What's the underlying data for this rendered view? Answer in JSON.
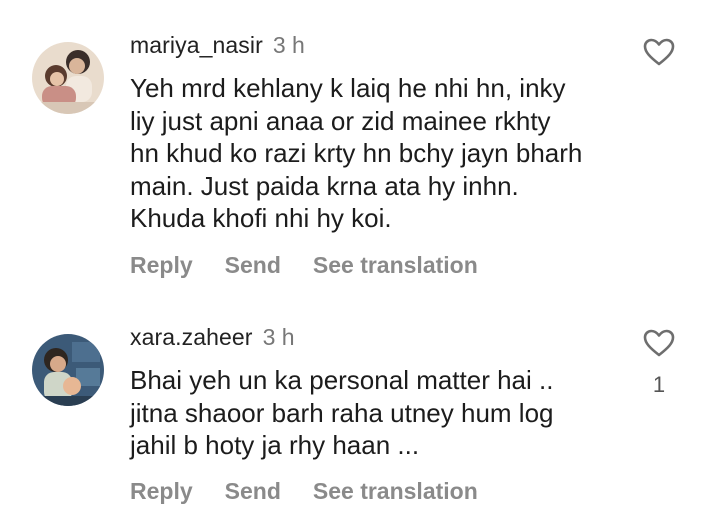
{
  "comments": [
    {
      "username": "mariya_nasir",
      "time": "3 h",
      "text_lines": [
        "Yeh mrd kehlany k laiq he nhi hn, inky",
        "liy just apni anaa or zid mainee rkhty",
        "hn khud ko razi krty hn bchy jayn bharh",
        "main. Just paida krna ata hy inhn.",
        "Khuda khofi nhi hy koi."
      ],
      "reply_label": "Reply",
      "send_label": "Send",
      "translate_label": "See translation",
      "likes": ""
    },
    {
      "username": "xara.zaheer",
      "time": "3 h",
      "text_lines": [
        "Bhai yeh un ka personal matter hai ..",
        "jitna shaoor barh raha utney hum log",
        "jahil b hoty ja rhy haan ..."
      ],
      "reply_label": "Reply",
      "send_label": "Send",
      "translate_label": "See translation",
      "likes": "1"
    }
  ],
  "icons": {
    "like": "heart-outline-icon"
  },
  "colors": {
    "text": "#1c1c1c",
    "muted": "#8a8a8a",
    "time": "#777777"
  }
}
